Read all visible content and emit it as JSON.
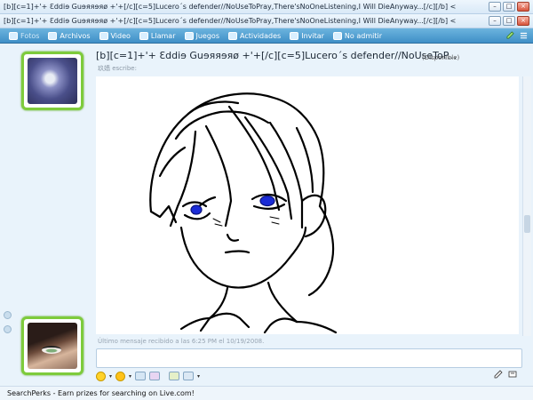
{
  "window": {
    "title_1": "[b][c=1]+'+ Ɛddiɘ Guɘяяɘяø +'+[/c][c=5]Lucero´s defender//NoUseToPray,There'sNoOneListening,I Will DieAnyway...[/c][/b]  <",
    "title_2": "[b][c=1]+'+ Ɛddiɘ Guɘяяɘяø +'+[/c][c=5]Lucero´s defender//NoUseToPray,There'sNoOneListening,I Will DieAnyway...[/c][/b]  <"
  },
  "toolbar": {
    "items": [
      {
        "label": "Fotos",
        "icon": "photo-icon",
        "dim": true
      },
      {
        "label": "Archivos",
        "icon": "folder-icon"
      },
      {
        "label": "Video",
        "icon": "video-icon"
      },
      {
        "label": "Llamar",
        "icon": "phone-icon"
      },
      {
        "label": "Juegos",
        "icon": "games-icon"
      },
      {
        "label": "Actividades",
        "icon": "activities-icon"
      },
      {
        "label": "Invitar",
        "icon": "invite-icon"
      },
      {
        "label": "No admitir",
        "icon": "block-icon"
      }
    ]
  },
  "chat": {
    "contact_name": "[b][c=1]+'+ Ɛddiɘ Guɘяяɘяø +'+[/c][c=5]Lucero´s defender//NoUseToP...",
    "status": "(Disponible)",
    "writing_text": "玖嫱 escribe:",
    "last_message": "Último mensaje recibido a las 6:25 PM el 10/19/2008."
  },
  "statusbar": {
    "text": "SearchPerks - Earn prizes for searching on Live.com!"
  },
  "colors": {
    "toolbar": "#4f9fd3",
    "avatar_border": "#7ecb3c",
    "ink": "#000000",
    "eye_ink": "#1a2bd6"
  }
}
